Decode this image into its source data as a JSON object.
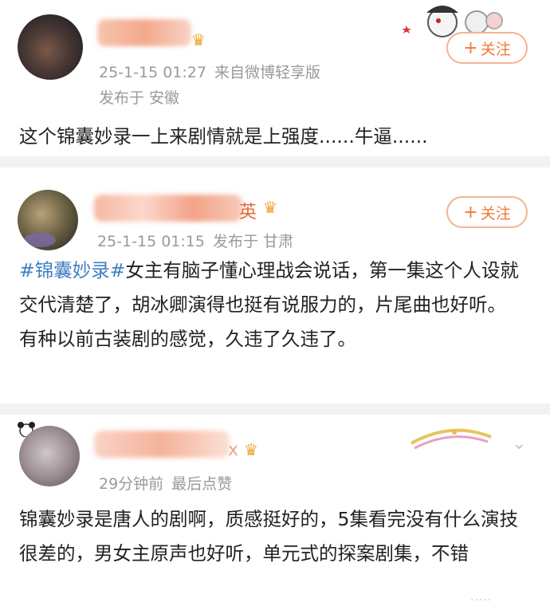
{
  "posts": [
    {
      "name_suffix": "",
      "time": "25-1-15 01:27",
      "source": "来自微博轻享版",
      "location": "发布于 安徽",
      "follow_label": "关注",
      "content": "这个锦囊妙录一上来剧情就是上强度......牛逼......"
    },
    {
      "name_suffix": "英",
      "time": "25-1-15 01:15",
      "location": "发布于 甘肃",
      "follow_label": "关注",
      "topic": "#锦囊妙录#",
      "content": "女主有脑子懂心理战会说话，第一集这个人设就交代清楚了，胡冰卿演得也挺有说服力的，片尾曲也好听。 有种以前古装剧的感觉，久违了久违了。"
    },
    {
      "name_suffix": "x",
      "time": "29分钟前",
      "note": "最后点赞",
      "content": "锦囊妙录是唐人的剧啊，质感挺好的，5集看完没有什么演技很差的，男女主原声也好听，单元式的探案剧集，不错"
    }
  ],
  "icons": {
    "follow_plus": "+",
    "expand": "chevron-down-icon",
    "vip": "crown-icon"
  },
  "colors": {
    "topic": "#3f7fc2",
    "follow": "#f07a3a",
    "meta": "#9a9a9a"
  }
}
